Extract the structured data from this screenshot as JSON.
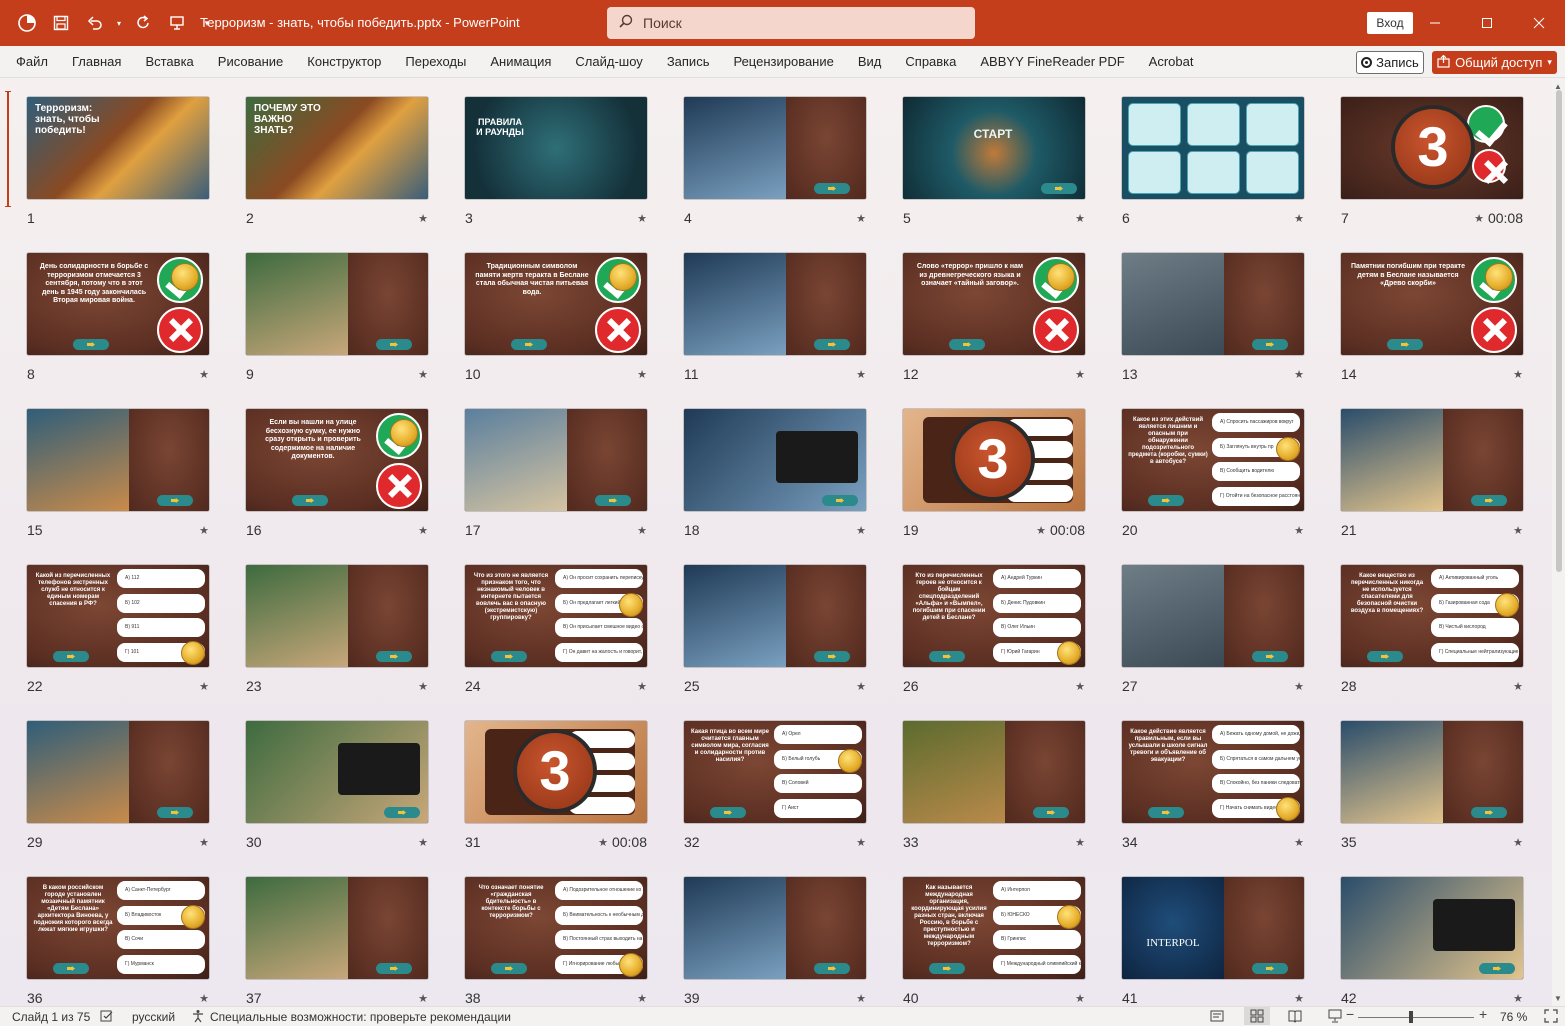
{
  "titlebar": {
    "doc_title": "Терроризм - знать, чтобы победить.pptx - PowerPoint",
    "search_placeholder": "Поиск",
    "signin_label": "Вход",
    "accent": "#c43e1c"
  },
  "ribbon": {
    "tabs": [
      "Файл",
      "Главная",
      "Вставка",
      "Рисование",
      "Конструктор",
      "Переходы",
      "Анимация",
      "Слайд-шоу",
      "Запись",
      "Рецензирование",
      "Вид",
      "Справка",
      "ABBYY FineReader PDF",
      "Acrobat"
    ],
    "record_label": "Запись",
    "share_label": "Общий доступ"
  },
  "slides": [
    {
      "num": "1",
      "star": false,
      "time": "",
      "kind": "title",
      "text": "Терроризм: знать, чтобы победить!"
    },
    {
      "num": "2",
      "star": true,
      "time": "",
      "kind": "title",
      "text": "ПОЧЕМУ ЭТО ВАЖНО ЗНАТЬ?"
    },
    {
      "num": "3",
      "star": true,
      "time": "",
      "kind": "rules",
      "text": "ПРАВИЛА И РАУНДЫ"
    },
    {
      "num": "4",
      "star": true,
      "time": "",
      "kind": "imgtext",
      "text": ""
    },
    {
      "num": "5",
      "star": true,
      "time": "",
      "kind": "start",
      "text": "СТАРТ"
    },
    {
      "num": "6",
      "star": true,
      "time": "",
      "kind": "menu",
      "text": ""
    },
    {
      "num": "7",
      "star": true,
      "time": "00:08",
      "kind": "timer",
      "text": "3"
    },
    {
      "num": "8",
      "star": true,
      "time": "",
      "kind": "tf",
      "text": "День солидарности в борьбе с терроризмом отмечается 3 сентября, потому что в этот день в 1945 году закончилась Вторая мировая война."
    },
    {
      "num": "9",
      "star": true,
      "time": "",
      "kind": "imgtext",
      "text": ""
    },
    {
      "num": "10",
      "star": true,
      "time": "",
      "kind": "tf",
      "text": "Традиционным символом памяти жертв теракта в Беслане стала обычная чистая питьевая вода."
    },
    {
      "num": "11",
      "star": true,
      "time": "",
      "kind": "imgtext",
      "text": ""
    },
    {
      "num": "12",
      "star": true,
      "time": "",
      "kind": "tf",
      "text": "Слово «террор» пришло к нам из древнегреческого языка и означает «тайный заговор»."
    },
    {
      "num": "13",
      "star": true,
      "time": "",
      "kind": "imgtext",
      "text": ""
    },
    {
      "num": "14",
      "star": true,
      "time": "",
      "kind": "tf",
      "text": "Памятник погибшим при теракте детям в Беслане называется «Древо скорби»"
    },
    {
      "num": "15",
      "star": true,
      "time": "",
      "kind": "imgtext",
      "text": ""
    },
    {
      "num": "16",
      "star": true,
      "time": "",
      "kind": "tf",
      "text": "Если вы нашли на улице бесхозную сумку, ее нужно сразу открыть и проверить содержимое на наличие документов."
    },
    {
      "num": "17",
      "star": true,
      "time": "",
      "kind": "imgtext",
      "text": ""
    },
    {
      "num": "18",
      "star": true,
      "time": "",
      "kind": "photo",
      "text": ""
    },
    {
      "num": "19",
      "star": true,
      "time": "00:08",
      "kind": "timer2",
      "text": "3"
    },
    {
      "num": "20",
      "star": true,
      "time": "",
      "kind": "quiz",
      "text": "Какое из этих действий является лишним и опасным при обнаружении подозрительного предмета (коробки, сумки) в автобусе?"
    },
    {
      "num": "21",
      "star": true,
      "time": "",
      "kind": "imgtext",
      "text": ""
    },
    {
      "num": "22",
      "star": true,
      "time": "",
      "kind": "quiz",
      "text": "Какой из перечисленных телефонов экстренных служб не относится к единым номерам спасения в РФ?"
    },
    {
      "num": "23",
      "star": true,
      "time": "",
      "kind": "imgtext",
      "text": ""
    },
    {
      "num": "24",
      "star": true,
      "time": "",
      "kind": "quiz",
      "text": "Что из этого не является признаком того, что незнакомый человек в интернете пытается вовлечь вас в опасную (экстремистскую) группировку?"
    },
    {
      "num": "25",
      "star": true,
      "time": "",
      "kind": "imgtext",
      "text": ""
    },
    {
      "num": "26",
      "star": true,
      "time": "",
      "kind": "quiz",
      "text": "Кто из перечисленных героев не относится к бойцам спецподразделений «Альфа» и «Вымпел», погибшим при спасении детей в Беслане?"
    },
    {
      "num": "27",
      "star": true,
      "time": "",
      "kind": "imgtext",
      "text": ""
    },
    {
      "num": "28",
      "star": true,
      "time": "",
      "kind": "quiz",
      "text": "Какое вещество из перечисленных никогда не используется спасателями для безопасной очистки воздуха в помещениях?"
    },
    {
      "num": "29",
      "star": true,
      "time": "",
      "kind": "imgtext",
      "text": ""
    },
    {
      "num": "30",
      "star": true,
      "time": "",
      "kind": "photo",
      "text": ""
    },
    {
      "num": "31",
      "star": true,
      "time": "00:08",
      "kind": "timer2",
      "text": "3"
    },
    {
      "num": "32",
      "star": true,
      "time": "",
      "kind": "quiz",
      "text": "Какая птица во всем мире считается главным символом мира, согласия и солидарности против насилия?"
    },
    {
      "num": "33",
      "star": true,
      "time": "",
      "kind": "imgtext",
      "text": ""
    },
    {
      "num": "34",
      "star": true,
      "time": "",
      "kind": "quiz",
      "text": "Какое действие является правильным, если вы услышали в школе сигнал тревоги и объявление об эвакуации?"
    },
    {
      "num": "35",
      "star": true,
      "time": "",
      "kind": "imgtext",
      "text": ""
    },
    {
      "num": "36",
      "star": true,
      "time": "",
      "kind": "quiz",
      "text": "В каком российском городе установлен мозаичный памятник «Детям Беслана» архитектора Виноева, у подножия которого всегда лежат мягкие игрушки?"
    },
    {
      "num": "37",
      "star": true,
      "time": "",
      "kind": "imgtext",
      "text": ""
    },
    {
      "num": "38",
      "star": true,
      "time": "",
      "kind": "quiz",
      "text": "Что означает понятие «гражданская бдительность» в контексте борьбы с терроризмом?"
    },
    {
      "num": "39",
      "star": true,
      "time": "",
      "kind": "imgtext",
      "text": ""
    },
    {
      "num": "40",
      "star": true,
      "time": "",
      "kind": "quiz",
      "text": "Как называется международная организация, координирующая усилия разных стран, включая Россию, в борьбе с преступностью и международным терроризмом?"
    },
    {
      "num": "41",
      "star": true,
      "time": "",
      "kind": "interpol",
      "text": "INTERPOL"
    },
    {
      "num": "42",
      "star": true,
      "time": "",
      "kind": "photo",
      "text": ""
    }
  ],
  "quiz_options": {
    "20": [
      "А) Спросить пассажиров вокруг",
      "Б) Заглянуть внутрь пр",
      "В) Сообщить водителю",
      "Г) Отойти на безопасное расстояние"
    ],
    "22": [
      "А) 112",
      "Б) 102",
      "В) 911",
      "Г) 101"
    ],
    "24": [
      "А) Он просит сохранить переписку в тайне от родителей",
      "Б) Он предлагает легкий заработок за простые задания",
      "В) Он присылает смешное видео с котиками без смысла",
      "Г) Он давит на жалость и говорит, что мир несправедлив"
    ],
    "26": [
      "А) Андрей Туркин",
      "Б) Денис Пудовкин",
      "В) Олег Ильин",
      "Г) Юрий Гагарин"
    ],
    "28": [
      "А) Активированный уголь",
      "Б) Газированная сода",
      "В) Чистый кислород",
      "Г) Специальные нейтрализующие растворы"
    ],
    "32": [
      "А) Орел",
      "Б) Белый голубь",
      "В) Соловей",
      "Г) Аист"
    ],
    "34": [
      "А) Бежать одному домой, не дожидаясь класса",
      "Б) Спрятаться в самом дальнем углу класса под партой",
      "В) Спокойно, без паники следовать за учителем к месту сбора",
      "Г) Начать снимать видео для блога"
    ],
    "36": [
      "А) Санкт-Петербург",
      "Б) Владивосток",
      "В) Сочи",
      "Г) Мурманск"
    ],
    "38": [
      "А) Подозрительное отношение ко всем своим друзьям",
      "Б) Внимательность к необычным деталям вокруг и умение сообщить о них службам безопасности",
      "В) Постоянный страх выходить на улицу",
      "Г) Игнорирование любых правил безопасности"
    ],
    "40": [
      "А) Интерпол",
      "Б) ЮНЕСКО",
      "В) Гринпис",
      "Г) Международный олимпийский комитет"
    ]
  },
  "statusbar": {
    "slide_info": "Слайд 1 из 75",
    "language": "русский",
    "accessibility": "Специальные возможности: проверьте рекомендации",
    "zoom": "76 %"
  }
}
